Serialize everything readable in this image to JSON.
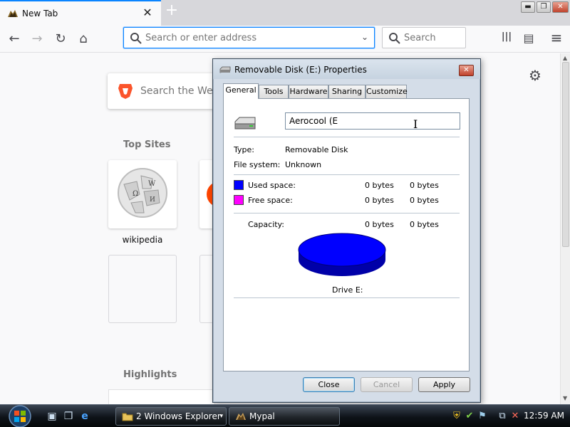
{
  "browser": {
    "tab": {
      "title": "New Tab",
      "close_glyph": "✕",
      "favicon": "mypal-icon"
    },
    "new_tab_glyph": "+",
    "window_controls": {
      "minimize": "▬",
      "restore": "❐",
      "close": "✕"
    },
    "nav": {
      "back_glyph": "←",
      "forward_glyph": "→",
      "reload_glyph": "↻",
      "home_glyph": "⌂"
    },
    "urlbar": {
      "placeholder": "Search or enter address",
      "dropdown_glyph": "⌄"
    },
    "searchbar": {
      "placeholder": "Search"
    },
    "toolbar": {
      "library_glyph": "|||",
      "sidebar_glyph": "▤",
      "menu_glyph": "≡"
    }
  },
  "newtab": {
    "search_placeholder": "Search the Web",
    "top_sites_title": "Top Sites",
    "highlights_title": "Highlights",
    "settings_glyph": "⚙",
    "tiles": [
      {
        "label": "wikipedia",
        "icon": "wikipedia-globe-icon"
      }
    ]
  },
  "dialog": {
    "title": "Removable Disk (E:) Properties",
    "close_glyph": "✕",
    "tabs": [
      "General",
      "Tools",
      "Hardware",
      "Sharing",
      "Customize"
    ],
    "active_tab": "General",
    "name_value": "Aerocool (E",
    "ibeam_glyph": "I",
    "type_label": "Type:",
    "type_value": "Removable Disk",
    "fs_label": "File system:",
    "fs_value": "Unknown",
    "used_label": "Used space:",
    "used_bytes": "0 bytes",
    "used_size": "0 bytes",
    "free_label": "Free space:",
    "free_bytes": "0 bytes",
    "free_size": "0 bytes",
    "capacity_label": "Capacity:",
    "capacity_bytes": "0 bytes",
    "capacity_size": "0 bytes",
    "drive_caption": "Drive E:",
    "buttons": {
      "close": "Close",
      "cancel": "Cancel",
      "apply": "Apply"
    },
    "colors": {
      "used": "#0000ff",
      "free": "#ff00ff"
    }
  },
  "taskbar": {
    "buttons": [
      {
        "label": "2 Windows Explorer",
        "icon": "folder-icon",
        "arrow": "▾"
      },
      {
        "label": "Mypal",
        "icon": "mypal-icon"
      }
    ],
    "quicklaunch": [
      "show-desktop-icon",
      "switch-windows-icon",
      "internet-explorer-icon"
    ],
    "tray_icons": [
      "security-shield-icon",
      "network-icon",
      "volume-muted-icon"
    ],
    "clock": "12:59 AM"
  }
}
